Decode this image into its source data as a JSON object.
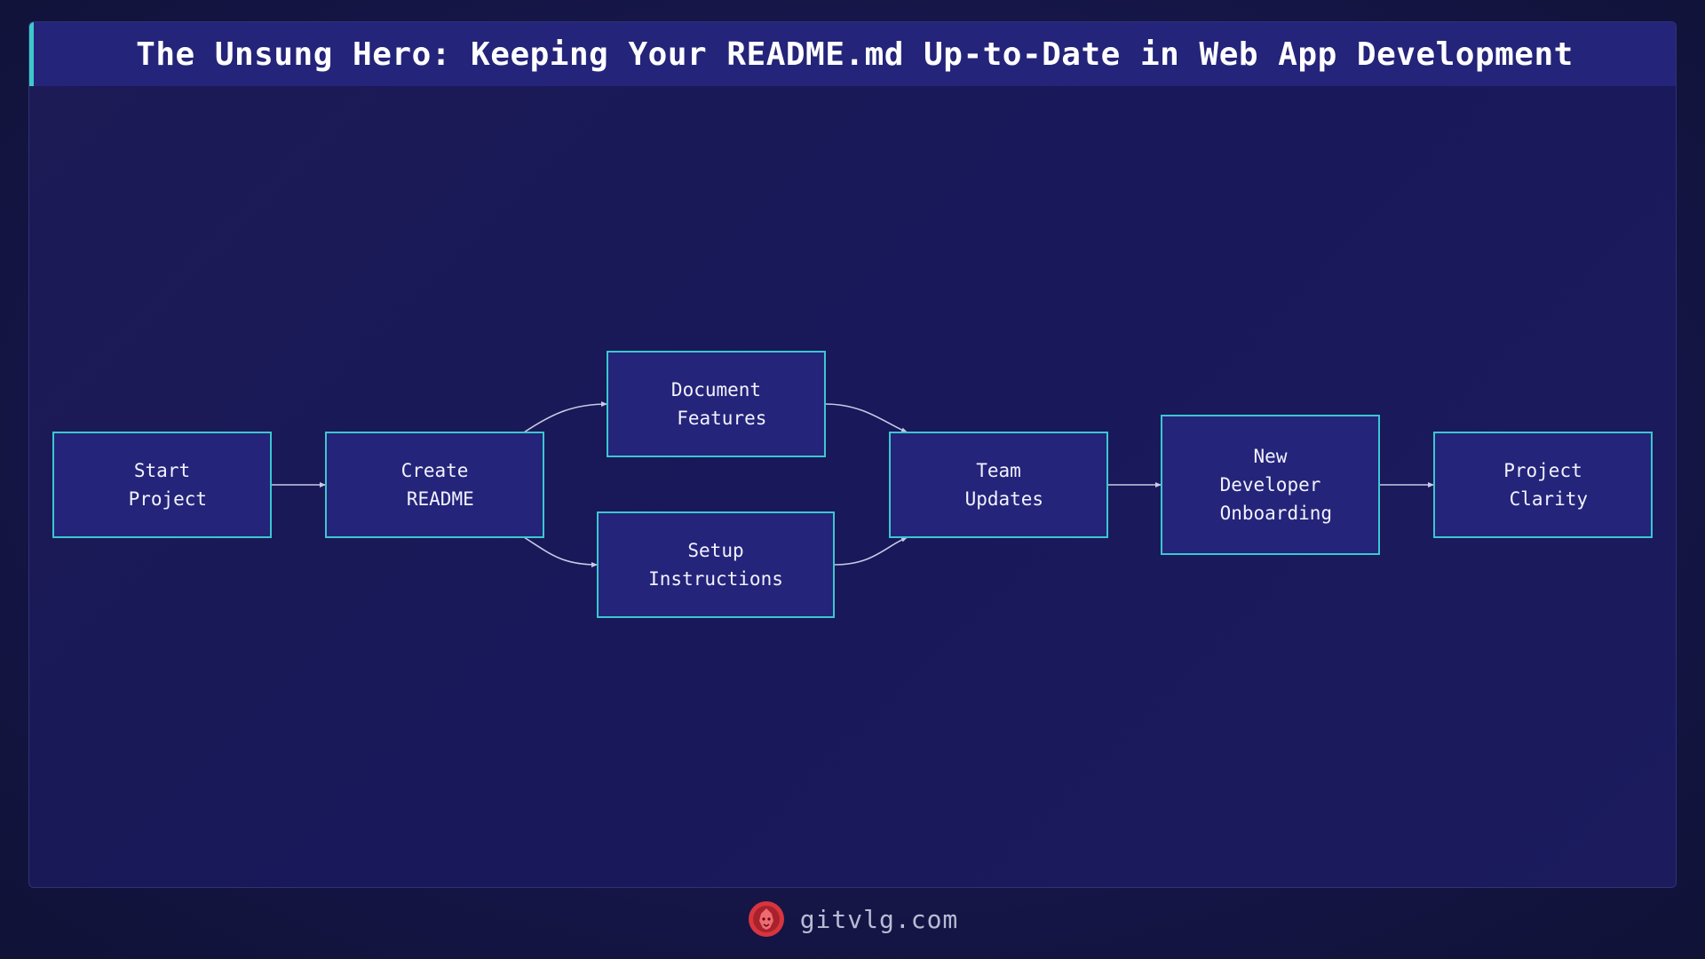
{
  "title": "The Unsung Hero: Keeping Your README.md Up-to-Date in Web App Development",
  "diagram": {
    "nodes": [
      {
        "id": "start",
        "lines": [
          "Start",
          " Project"
        ]
      },
      {
        "id": "create",
        "lines": [
          "Create",
          " README"
        ]
      },
      {
        "id": "document",
        "lines": [
          "Document",
          " Features"
        ]
      },
      {
        "id": "setup",
        "lines": [
          "Setup",
          "Instructions"
        ]
      },
      {
        "id": "team",
        "lines": [
          "Team",
          " Updates"
        ]
      },
      {
        "id": "newdev",
        "lines": [
          "New",
          "Developer",
          " Onboarding"
        ]
      },
      {
        "id": "clarity",
        "lines": [
          "Project",
          " Clarity"
        ]
      }
    ],
    "edges": [
      {
        "from": "start",
        "to": "create"
      },
      {
        "from": "create",
        "to": "document"
      },
      {
        "from": "create",
        "to": "setup"
      },
      {
        "from": "document",
        "to": "team"
      },
      {
        "from": "setup",
        "to": "team"
      },
      {
        "from": "team",
        "to": "newdev"
      },
      {
        "from": "newdev",
        "to": "clarity"
      }
    ]
  },
  "footer": {
    "site": "gitvlg.com",
    "logo_icon": "lion-logo-icon"
  },
  "colors": {
    "node_fill": "#24247a",
    "node_border": "#3cc7cf",
    "title_accent": "#3ec9c9",
    "logo": "#d8353f"
  }
}
